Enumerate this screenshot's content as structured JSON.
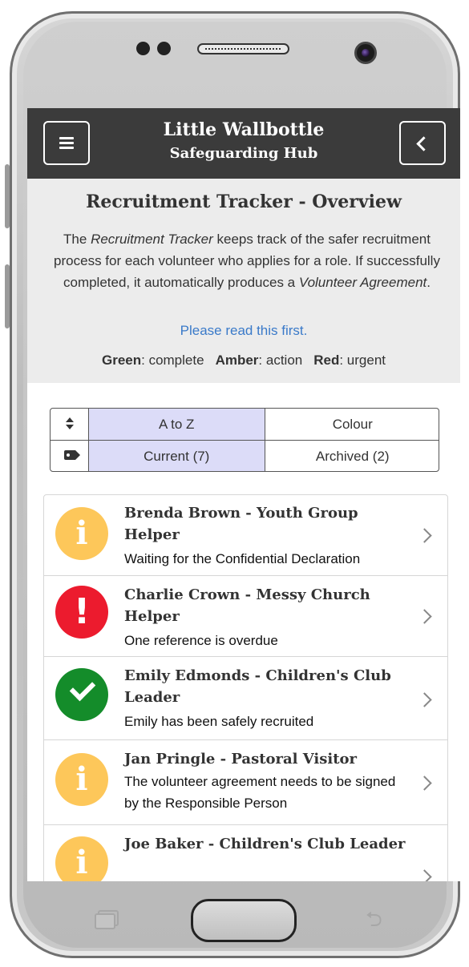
{
  "header": {
    "title": "Little Wallbottle",
    "subtitle": "Safeguarding Hub"
  },
  "intro": {
    "heading": "Recruitment Tracker - Overview",
    "text_prefix": "The ",
    "text_em1": "Recruitment Tracker",
    "text_mid": " keeps track of the safer recruitment process for each volunteer who applies for a role. If successfully completed, it automatically produces a ",
    "text_em2": "Volunteer Agreement",
    "text_suffix": ".",
    "link": "Please read this first.",
    "legend": {
      "green_label": "Green",
      "green_text": ": complete",
      "amber_label": "Amber",
      "amber_text": ": action",
      "red_label": "Red",
      "red_text": ": urgent"
    }
  },
  "filters": {
    "sort_options": [
      "A to Z",
      "Colour"
    ],
    "sort_selected": "A to Z",
    "status_options": [
      "Current (7)",
      "Archived (2)"
    ],
    "status_selected": "Current (7)"
  },
  "items": [
    {
      "status": "info",
      "title": "Brenda Brown - Youth Group Helper",
      "subtitle": "Waiting for the Confidential Declaration"
    },
    {
      "status": "urgent",
      "title": "Charlie Crown - Messy Church Helper",
      "subtitle": "One reference is overdue"
    },
    {
      "status": "ok",
      "title": "Emily Edmonds - Children's Club Leader",
      "subtitle": "Emily has been safely recruited"
    },
    {
      "status": "info",
      "title": "Jan Pringle - Pastoral Visitor",
      "subtitle": "The volunteer agreement needs to be signed by the Responsible Person"
    },
    {
      "status": "info",
      "title": "Joe Baker - Children's Club Leader",
      "subtitle": ""
    }
  ],
  "colors": {
    "header_bg": "#3b3b3b",
    "amber": "#fdc75a",
    "red": "#ec1b2e",
    "green": "#148c2a",
    "link": "#3a7ac9",
    "selected_filter": "#dcdcf8"
  },
  "icons": {
    "menu": "hamburger-icon",
    "back": "chevron-left-icon",
    "sort": "sort-icon",
    "tag": "tag-icon",
    "info": "info-icon",
    "urgent": "exclamation-icon",
    "ok": "check-icon",
    "row_chevron": "chevron-right-icon"
  }
}
